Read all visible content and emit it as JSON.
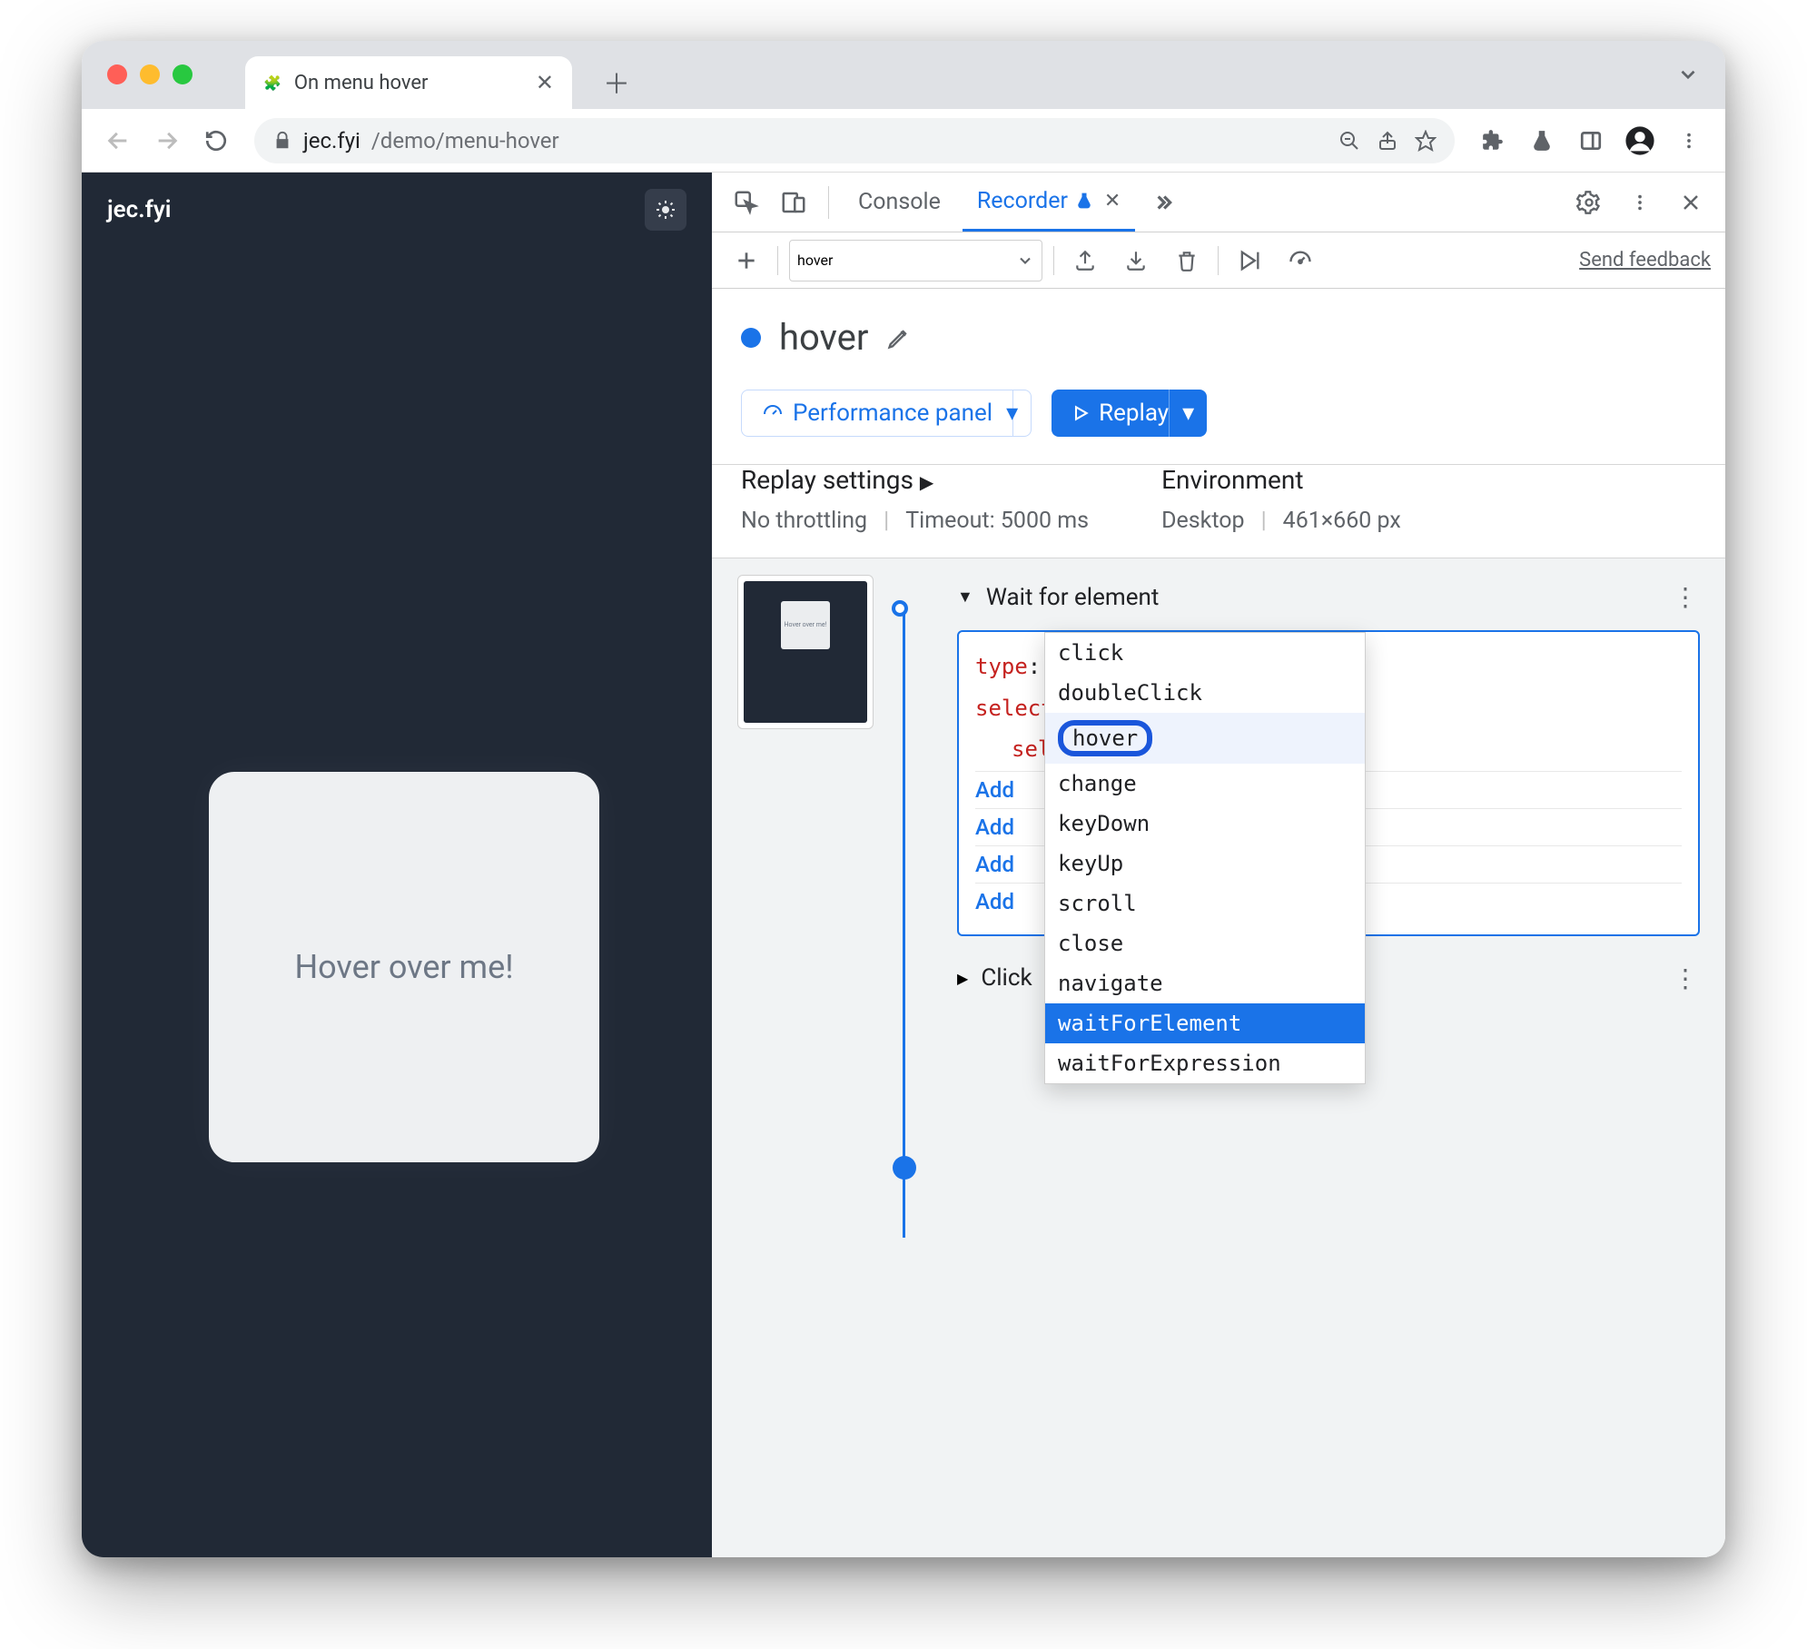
{
  "browser": {
    "tab_title": "On menu hover",
    "url_domain": "jec.fyi",
    "url_path": "/demo/menu-hover"
  },
  "page": {
    "brand": "jec.fyi",
    "card_text": "Hover over me!"
  },
  "devtools": {
    "tabs": {
      "console": "Console",
      "recorder": "Recorder"
    },
    "recording_name": "hover",
    "send_feedback": "Send feedback",
    "title": "hover",
    "perf_button": "Performance panel",
    "replay_button": "Replay",
    "replay_settings_label": "Replay settings",
    "throttling": "No throttling",
    "timeout": "Timeout: 5000 ms",
    "environment_label": "Environment",
    "env_device": "Desktop",
    "env_size": "461×660 px",
    "thumb_text": "Hover over me!",
    "step1_label": "Wait for element",
    "editor": {
      "type_key": "type",
      "selectors_key": "selectors",
      "sel_prefix": "sel",
      "add_buttons": [
        "Add",
        "Add",
        "Add",
        "Add"
      ]
    },
    "autocomplete": [
      "click",
      "doubleClick",
      "hover",
      "change",
      "keyDown",
      "keyUp",
      "scroll",
      "close",
      "navigate",
      "waitForElement",
      "waitForExpression"
    ],
    "ac_highlight": "hover",
    "ac_selected": "waitForElement",
    "step2_label": "Click"
  }
}
